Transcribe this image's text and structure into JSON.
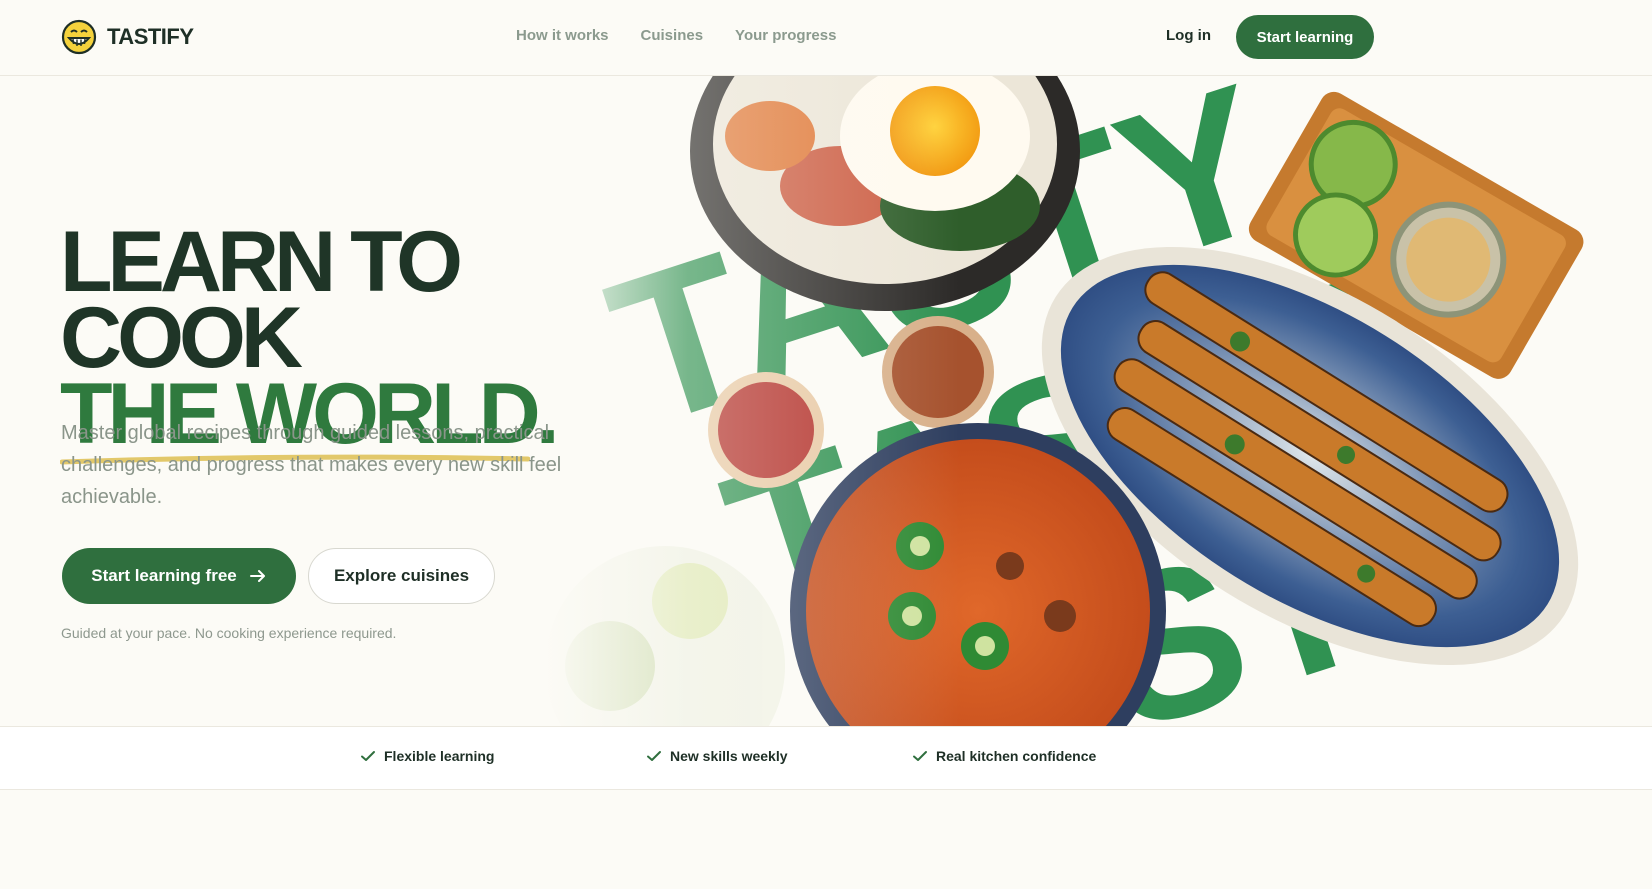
{
  "nav": {
    "brand": "TASTIFY",
    "links": [
      "How it works",
      "Cuisines",
      "Your progress"
    ],
    "login": "Log in",
    "cta": "Start learning"
  },
  "hero": {
    "headline_line1": "LEARN TO",
    "headline_line2": "COOK",
    "headline_line3": "THE WORLD.",
    "subtitle": "Master global recipes through guided lessons, practical challenges, and progress that makes every new skill feel achievable.",
    "primary_cta": "Start learning free",
    "secondary_cta": "Explore cuisines",
    "note": "Guided at your pace. No cooking experience required.",
    "art_watermark": "TASTY"
  },
  "features": [
    {
      "label": "Flexible learning"
    },
    {
      "label": "New skills weekly"
    },
    {
      "label": "Real kitchen confidence"
    }
  ],
  "colors": {
    "accent": "#2f6f3e",
    "accent_bright": "#2f7a3e",
    "dark_text": "#1f3527",
    "muted_text": "#8a958a",
    "underline": "#e2c86a",
    "background": "#fcfbf6"
  },
  "icons": {
    "logo": "smiling-face-logo-icon",
    "arrow": "arrow-right-icon",
    "check": "check-icon"
  }
}
